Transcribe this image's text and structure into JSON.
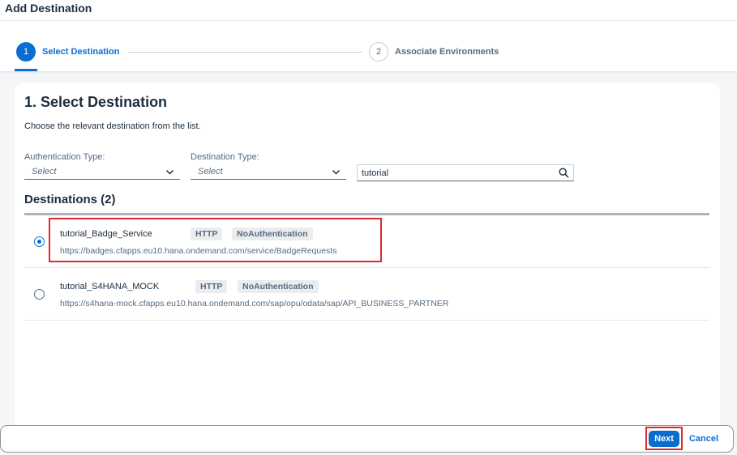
{
  "dialog": {
    "title": "Add Destination"
  },
  "wizard": {
    "steps": [
      {
        "number": "1",
        "label": "Select Destination",
        "active": true
      },
      {
        "number": "2",
        "label": "Associate Environments",
        "active": false
      }
    ]
  },
  "section": {
    "title": "1. Select Destination",
    "description": "Choose the relevant destination from the list."
  },
  "filters": {
    "auth_type": {
      "label": "Authentication Type:",
      "placeholder": "Select"
    },
    "dest_type": {
      "label": "Destination Type:",
      "placeholder": "Select"
    },
    "search": {
      "value": "tutorial"
    }
  },
  "list": {
    "title": "Destinations (2)",
    "items": [
      {
        "name": "tutorial_Badge_Service",
        "protocol": "HTTP",
        "auth": "NoAuthentication",
        "url": "https://badges.cfapps.eu10.hana.ondemand.com/service/BadgeRequests",
        "selected": true
      },
      {
        "name": "tutorial_S4HANA_MOCK",
        "protocol": "HTTP",
        "auth": "NoAuthentication",
        "url": "https://s4hana-mock.cfapps.eu10.hana.ondemand.com/sap/opu/odata/sap/API_BUSINESS_PARTNER",
        "selected": false
      }
    ]
  },
  "footer": {
    "next_label": "Next",
    "cancel_label": "Cancel"
  },
  "colors": {
    "accent": "#0a6ed1",
    "highlight": "#e0292c",
    "text": "#1d2d3e",
    "muted": "#556b82"
  },
  "icons": {
    "dropdown": "chevron-down-icon",
    "search": "search-icon"
  }
}
